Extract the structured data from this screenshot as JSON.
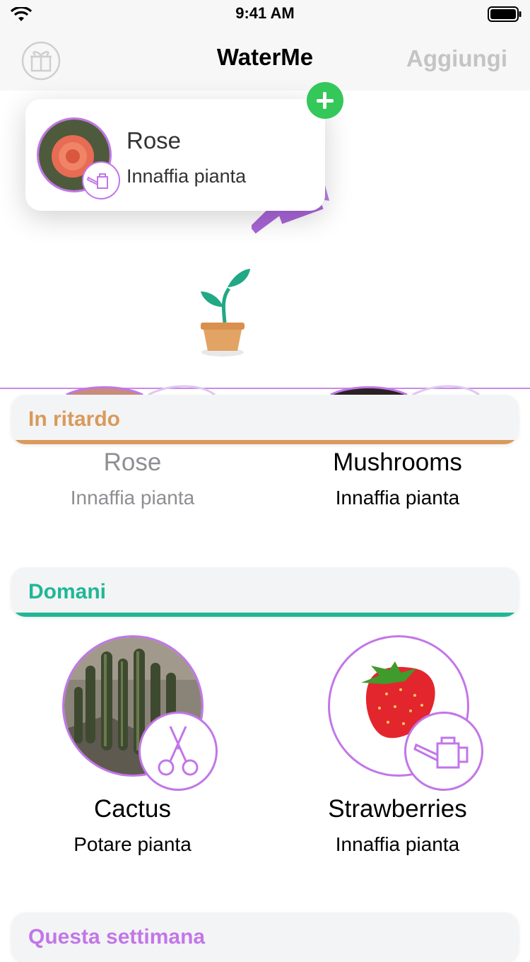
{
  "status": {
    "time": "9:41 AM"
  },
  "nav": {
    "title": "WaterMe",
    "add_label": "Aggiungi"
  },
  "dragging": {
    "name": "Rose",
    "task": "Innaffia pianta"
  },
  "sections": [
    {
      "title": "In ritardo",
      "color": "#d99a5b",
      "items": [
        {
          "name": "Rose",
          "task": "Innaffia pianta"
        },
        {
          "name": "Mushrooms",
          "task": "Innaffia pianta"
        }
      ]
    },
    {
      "title": "Domani",
      "color": "#20b795",
      "items": [
        {
          "name": "Cactus",
          "task": "Potare pianta"
        },
        {
          "name": "Strawberries",
          "task": "Innaffia pianta"
        }
      ]
    },
    {
      "title": "Questa settimana",
      "color": "#c276e8",
      "items": []
    }
  ],
  "colors": {
    "accent": "#c276e8",
    "add_green": "#34c759"
  },
  "icons": [
    "wifi-icon",
    "battery-icon",
    "gift-icon",
    "plus-icon",
    "watering-can-icon",
    "scissors-icon",
    "plant-pot-icon"
  ]
}
